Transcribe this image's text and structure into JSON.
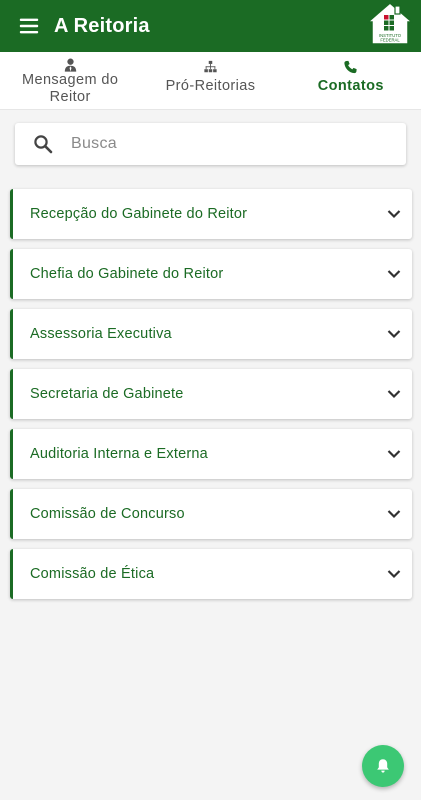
{
  "app": {
    "title": "A Reitoria"
  },
  "colors": {
    "primary": "#1b6b24",
    "fab": "#3cc874",
    "background": "#f4f4f4"
  },
  "logo": {
    "line1": "INSTITUTO",
    "line2": "FEDERAL"
  },
  "tabs": [
    {
      "label": "Mensagem do Reitor",
      "icon": "user-tie-icon",
      "active": false
    },
    {
      "label": "Pró-Reitorias",
      "icon": "sitemap-icon",
      "active": false
    },
    {
      "label": "Contatos",
      "icon": "phone-icon",
      "active": true
    }
  ],
  "search": {
    "placeholder": "Busca",
    "value": ""
  },
  "items": [
    {
      "label": "Recepção do Gabinete do Reitor"
    },
    {
      "label": "Chefia do Gabinete do Reitor"
    },
    {
      "label": "Assessoria Executiva"
    },
    {
      "label": "Secretaria de Gabinete"
    },
    {
      "label": "Auditoria Interna e Externa"
    },
    {
      "label": "Comissão de Concurso"
    },
    {
      "label": "Comissão de Ética"
    }
  ],
  "fab": {
    "icon": "bell-icon"
  }
}
